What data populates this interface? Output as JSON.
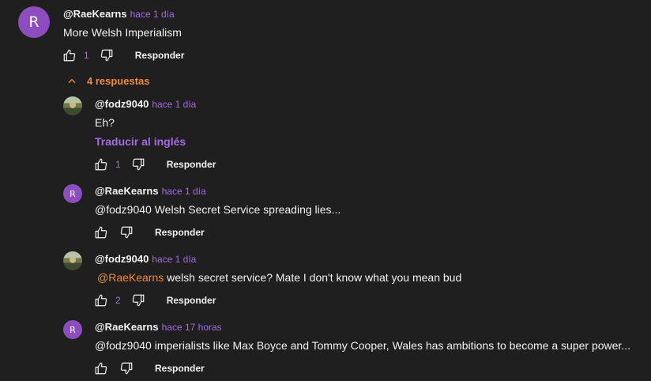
{
  "top_comment": {
    "avatar_letter": "R",
    "author": "@RaeKearns",
    "time": "hace 1 día",
    "text": "More Welsh Imperialism",
    "likes": "1",
    "reply_label": "Responder",
    "avatar_color": "#8e4dbf"
  },
  "replies_toggle": {
    "label": "4 respuestas",
    "icon": "chevron-up-icon",
    "color": "#f08a3c"
  },
  "replies": [
    {
      "author": "@fodz9040",
      "time": "hace 1 día",
      "text": "Eh?",
      "translate_label": "Traducir al inglés",
      "likes": "1",
      "reply_label": "Responder",
      "avatar": "photo"
    },
    {
      "author": "@RaeKearns",
      "time": "hace 1 día",
      "text": "@fodz9040  Welsh Secret Service spreading lies...",
      "likes": "",
      "reply_label": "Responder",
      "avatar_letter": "R"
    },
    {
      "author": "@fodz9040",
      "time": "hace 1 día",
      "mention": "@RaeKearns",
      "text": " welsh secret service? Mate I don't know what you mean bud",
      "likes": "2",
      "reply_label": "Responder",
      "avatar": "photo"
    },
    {
      "author": "@RaeKearns",
      "time": "hace 17 horas",
      "text": "@fodz9040  imperialists like Max Boyce and Tommy Cooper, Wales has ambitions to become a super power...",
      "likes": "",
      "reply_label": "Responder",
      "avatar_letter": "R"
    }
  ],
  "colors": {
    "background": "#1f1f1f",
    "accent_purple": "#a56be0",
    "accent_orange": "#f08a3c"
  }
}
